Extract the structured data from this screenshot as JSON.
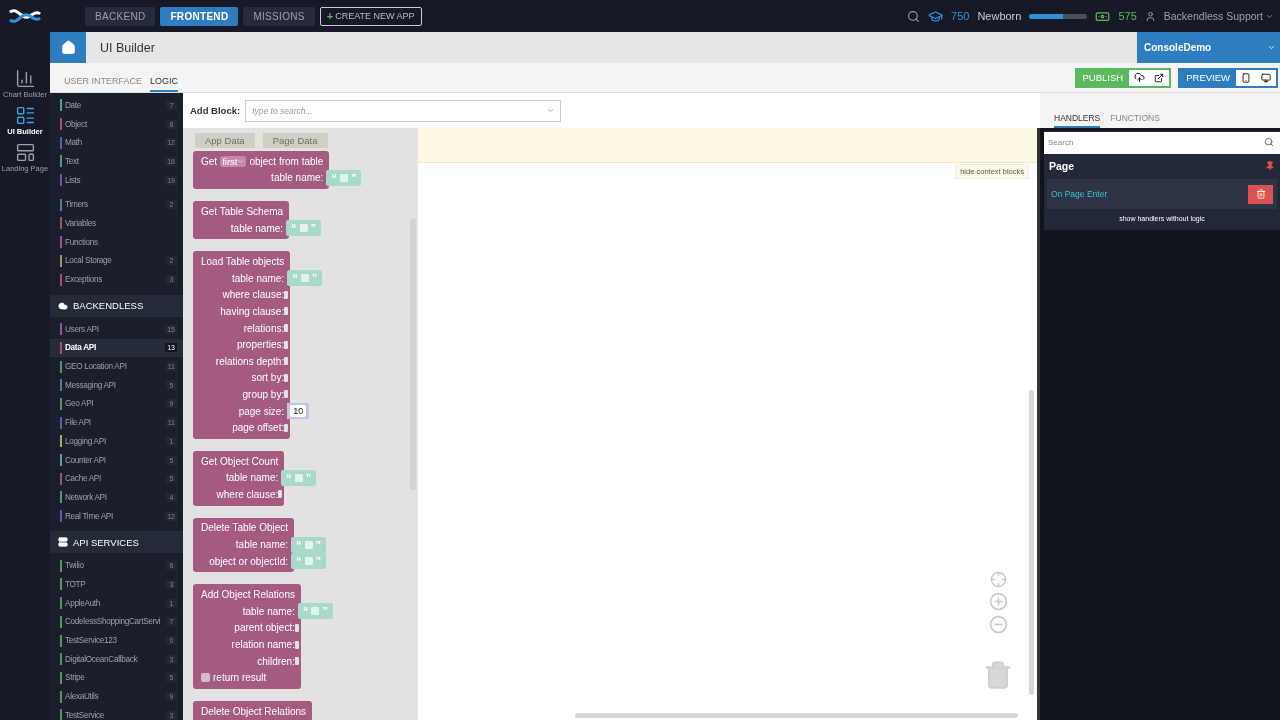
{
  "top_bar": {
    "tabs": [
      {
        "label": "BACKEND",
        "selected": false
      },
      {
        "label": "FRONTEND",
        "selected": true
      },
      {
        "label": "MISSIONS",
        "selected": false
      }
    ],
    "create_plus": "+",
    "create_button": "CREATE NEW APP",
    "points": "750",
    "rank": "Newborn",
    "rank_progress": {
      "level": 0.58
    },
    "coins": "575",
    "user": "Backendless Support"
  },
  "rail": [
    {
      "label": "Chart Builder",
      "selected": false
    },
    {
      "label": "UI Builder",
      "selected": true
    },
    {
      "label": "Landing Page",
      "selected": false
    }
  ],
  "header": {
    "title": "UI Builder",
    "app": "ConsoleDemo"
  },
  "editor_tabs": [
    {
      "label": "USER INTERFACE",
      "selected": false
    },
    {
      "label": "LOGIC",
      "selected": true
    }
  ],
  "actions": {
    "publish": "PUBLISH",
    "preview": "PREVIEW"
  },
  "category_groups": [
    {
      "items": [
        {
          "label": "Date",
          "count": "7",
          "color": "#4fa39a",
          "selected": false
        },
        {
          "label": "Object",
          "count": "8",
          "color": "#a5506f",
          "selected": false
        },
        {
          "label": "Math",
          "count": "12",
          "color": "#5462a8",
          "selected": false
        },
        {
          "label": "Text",
          "count": "16",
          "color": "#4f9a78",
          "selected": false
        },
        {
          "label": "Lists",
          "count": "19",
          "color": "#7356a8",
          "selected": false
        }
      ]
    },
    {
      "items": [
        {
          "label": "Timers",
          "count": "2",
          "color": "#4f7aa8",
          "selected": false
        },
        {
          "label": "Variables",
          "color": "#a5506f",
          "selected": false
        },
        {
          "label": "Functions",
          "color": "#9a4fa0",
          "selected": false
        },
        {
          "label": "Local Storage",
          "count": "2",
          "color": "#a8925a",
          "selected": false
        },
        {
          "label": "Exceptions",
          "count": "3",
          "color": "#a5506f",
          "selected": false
        }
      ]
    },
    {
      "title": "BACKENDLESS",
      "items": [
        {
          "label": "Users API",
          "count": "15",
          "color": "#9a4fa0",
          "selected": false
        },
        {
          "label": "Data API",
          "count": "13",
          "color": "#a5506f",
          "selected": true
        },
        {
          "label": "GEO Location API",
          "count": "11",
          "color": "#4f9a5a",
          "selected": false
        },
        {
          "label": "Messaging API",
          "count": "5",
          "color": "#4f7aa8",
          "selected": false
        },
        {
          "label": "Geo API",
          "count": "9",
          "color": "#4f9a5a",
          "selected": false
        },
        {
          "label": "File API",
          "count": "11",
          "color": "#5462a8",
          "selected": false
        },
        {
          "label": "Logging API",
          "count": "1",
          "color": "#a8a85a",
          "selected": false
        },
        {
          "label": "Counter API",
          "count": "5",
          "color": "#4fa3a8",
          "selected": false
        },
        {
          "label": "Cache API",
          "count": "5",
          "color": "#a5506f",
          "selected": false
        },
        {
          "label": "Network API",
          "count": "4",
          "color": "#4f9a78",
          "selected": false
        },
        {
          "label": "Real Time API",
          "count": "12",
          "color": "#5462a8",
          "selected": false
        }
      ]
    },
    {
      "title": "API SERVICES",
      "items": [
        {
          "label": "Twilio",
          "count": "6",
          "color": "#4f9a5a",
          "selected": false
        },
        {
          "label": "TOTP",
          "count": "3",
          "color": "#4f9a5a",
          "selected": false
        },
        {
          "label": "AppleAuth",
          "count": "1",
          "color": "#4f9a5a",
          "selected": false
        },
        {
          "label": "CodelessShoppingCartServi",
          "count": "7",
          "color": "#4f9a5a",
          "selected": false
        },
        {
          "label": "TestService123",
          "count": "0",
          "color": "#4f9a5a",
          "selected": false
        },
        {
          "label": "DigitalOceanCallback",
          "count": "3",
          "color": "#4f9a5a",
          "selected": false
        },
        {
          "label": "Stripe",
          "count": "5",
          "color": "#4f9a5a",
          "selected": false
        },
        {
          "label": "AlexaUtils",
          "count": "9",
          "color": "#4f9a5a",
          "selected": false
        },
        {
          "label": "TestService",
          "count": "3",
          "color": "#4f9a5a",
          "selected": false
        }
      ]
    }
  ],
  "add_block": {
    "label": "Add Block:",
    "placeholder": "type to search..."
  },
  "flyout": {
    "context_chips": [
      "App Data",
      "Page Data"
    ],
    "blocks": [
      {
        "title": [
          {
            "kind": "text",
            "text": "Get"
          },
          {
            "kind": "dropdown",
            "text": "first"
          },
          {
            "kind": "text",
            "text": "object from table"
          }
        ],
        "inputs": [
          {
            "label": "table name:",
            "kind": "string",
            "open": "“",
            "close": "”"
          }
        ]
      },
      {
        "title": [
          {
            "kind": "text",
            "text": "Get Table Schema"
          }
        ],
        "inputs": [
          {
            "label": "table name:",
            "kind": "string",
            "open": "“",
            "close": "”"
          }
        ]
      },
      {
        "title": [
          {
            "kind": "text",
            "text": "Load Table objects"
          }
        ],
        "inputs": [
          {
            "label": "table name:",
            "kind": "string",
            "open": "“",
            "close": "”"
          },
          {
            "label": "where clause:",
            "kind": "socket"
          },
          {
            "label": "having clause:",
            "kind": "socket"
          },
          {
            "label": "relations:",
            "kind": "socket"
          },
          {
            "label": "properties:",
            "kind": "socket"
          },
          {
            "label": "relations depth:",
            "kind": "socket"
          },
          {
            "label": "sort by:",
            "kind": "socket"
          },
          {
            "label": "group by:",
            "kind": "socket"
          },
          {
            "label": "page size:",
            "kind": "number",
            "value": "10"
          },
          {
            "label": "page offset:",
            "kind": "socket"
          }
        ]
      },
      {
        "title": [
          {
            "kind": "text",
            "text": "Get Object Count"
          }
        ],
        "inputs": [
          {
            "label": "table name:",
            "kind": "string",
            "open": "“",
            "close": "”"
          },
          {
            "label": "where clause:",
            "kind": "socket"
          }
        ]
      },
      {
        "title": [
          {
            "kind": "text",
            "text": "Delete Table Object"
          }
        ],
        "inputs": [
          {
            "label": "table name:",
            "kind": "string",
            "open": "“",
            "close": "”"
          },
          {
            "label": "object or objectId:",
            "kind": "string",
            "open": "“",
            "close": "”"
          }
        ]
      },
      {
        "title": [
          {
            "kind": "text",
            "text": "Add Object Relations"
          }
        ],
        "inputs": [
          {
            "label": "table name:",
            "kind": "string",
            "open": "“",
            "close": "”"
          },
          {
            "label": "parent object:",
            "kind": "socket"
          },
          {
            "label": "relation name:",
            "kind": "socket"
          },
          {
            "label": "children:",
            "kind": "socket"
          },
          {
            "label": "return result",
            "kind": "checkbox",
            "checked": false
          }
        ]
      },
      {
        "title": [
          {
            "kind": "text",
            "text": "Delete Object Relations"
          }
        ]
      }
    ]
  },
  "canvas": {
    "hide_context": "hide context blocks"
  },
  "side_tabs": [
    {
      "label": "HANDLERS",
      "selected": true
    },
    {
      "label": "FUNCTIONS",
      "selected": false
    }
  ],
  "handlers": {
    "search_placeholder": "Search",
    "section": "Page",
    "items": [
      "On Page Enter"
    ],
    "show_more": "show handlers without logic"
  }
}
